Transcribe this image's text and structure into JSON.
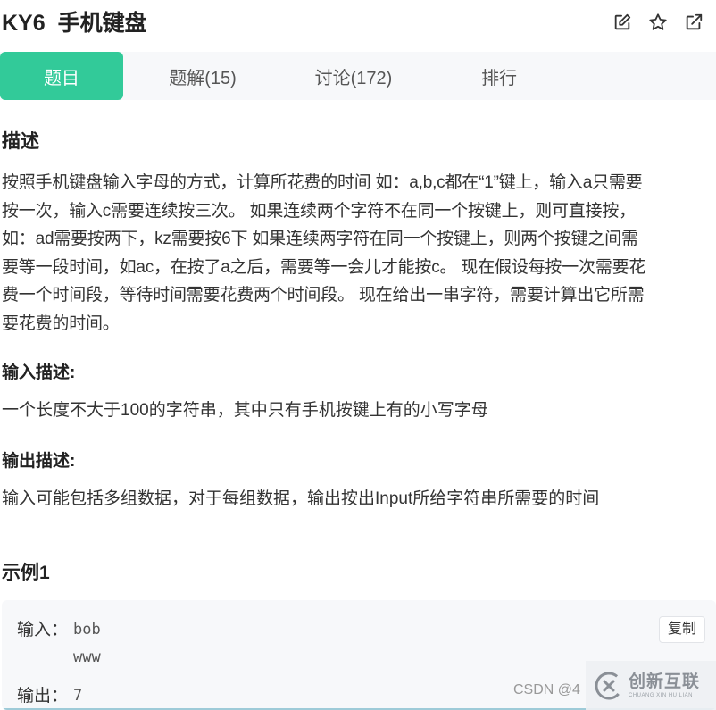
{
  "header": {
    "code": "KY6",
    "title": "手机键盘",
    "icons": [
      "edit-icon",
      "star-icon",
      "share-icon"
    ]
  },
  "tabs": [
    {
      "label": "题目",
      "active": true
    },
    {
      "label": "题解(15)",
      "active": false
    },
    {
      "label": "讨论(172)",
      "active": false
    },
    {
      "label": "排行",
      "active": false
    }
  ],
  "description": {
    "title": "描述",
    "lines": [
      "按照手机键盘输入字母的方式，计算所花费的时间 如：a,b,c都在“1”键上，输入a只需要",
      "按一次，输入c需要连续按三次。 如果连续两个字符不在同一个按键上，则可直接按，",
      "如：ad需要按两下，kz需要按6下 如果连续两字符在同一个按键上，则两个按键之间需",
      "要等一段时间，如ac，在按了a之后，需要等一会儿才能按c。 现在假设每按一次需要花",
      "费一个时间段，等待时间需要花费两个时间段。 现在给出一串字符，需要计算出它所需",
      "要花费的时间。"
    ]
  },
  "input_desc": {
    "title": "输入描述:",
    "text": "一个长度不大于100的字符串，其中只有手机按键上有的小写字母"
  },
  "output_desc": {
    "title": "输出描述:",
    "text": "输入可能包括多组数据，对于每组数据，输出按出Input所给字符串所需要的时间"
  },
  "example": {
    "title": "示例1",
    "input_label": "输入：",
    "input_lines": [
      "bob",
      "www"
    ],
    "output_label": "输出：",
    "output_value": "7",
    "copy_label": "复制"
  },
  "watermark": {
    "text": "CSDN @4"
  },
  "logo": {
    "main": "创新互联",
    "sub": "CHUANG XIN HU LIAN"
  },
  "colors": {
    "accent": "#32ca99",
    "tab_bar_bg": "#f7f8fa"
  }
}
